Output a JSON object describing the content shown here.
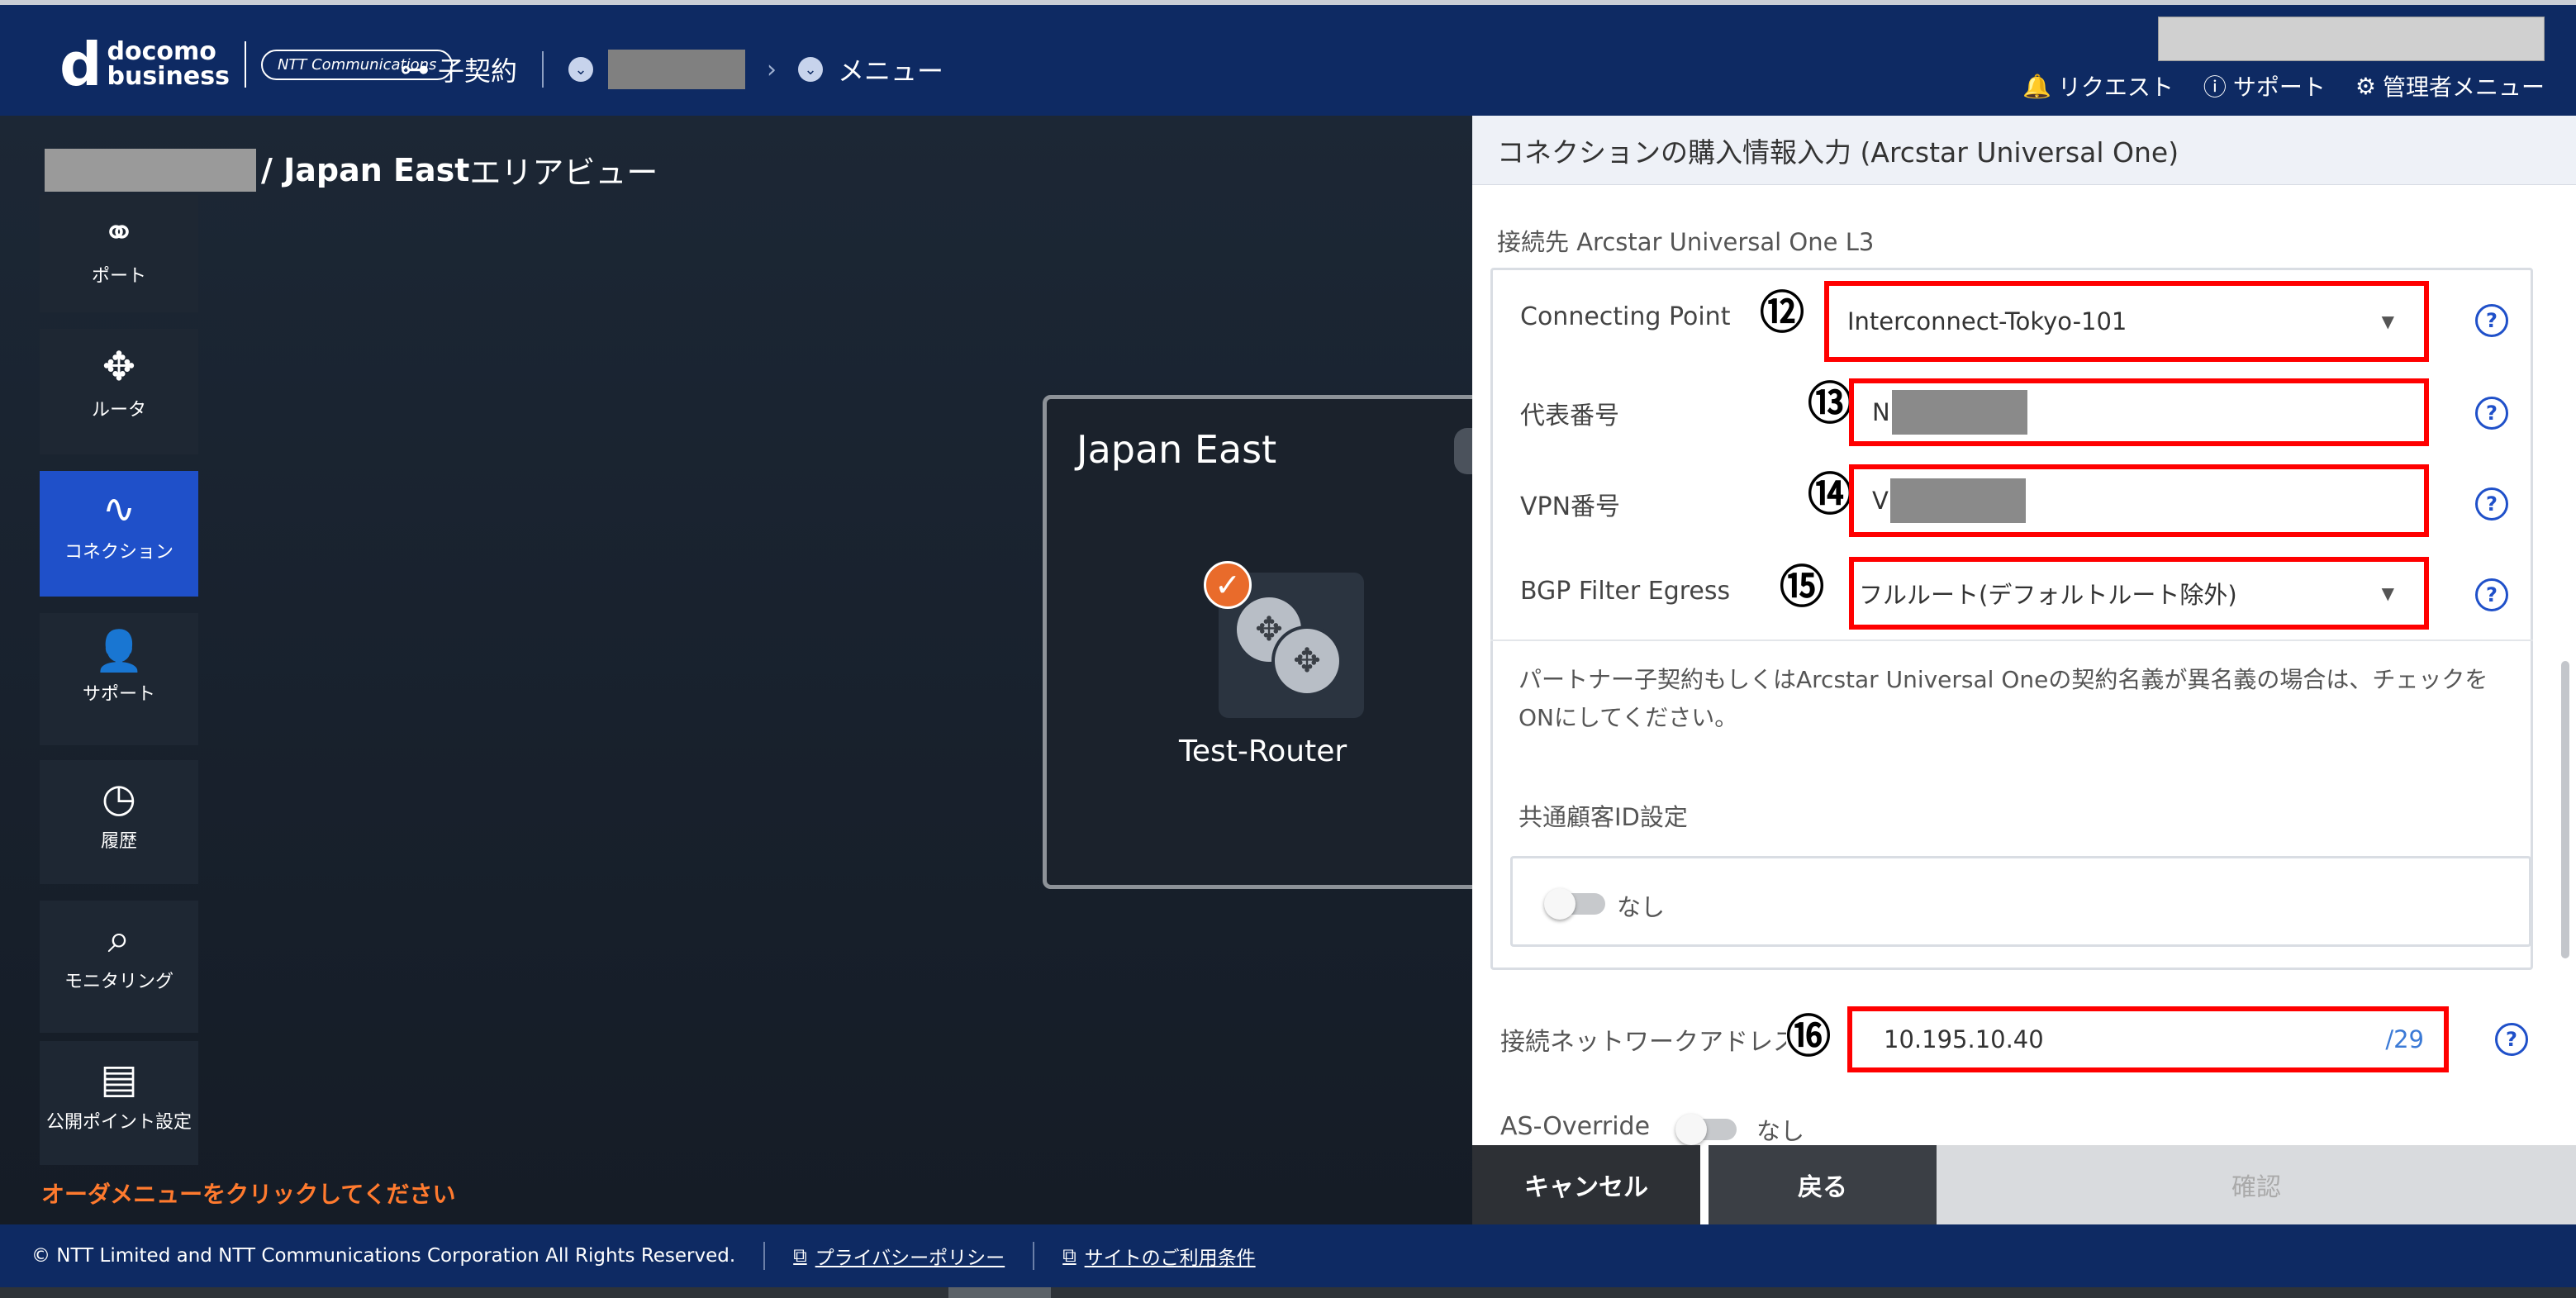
{
  "header": {
    "logo_docomo": "docomo",
    "logo_business": "business",
    "ntt_badge": "NTT Communications",
    "breadcrumb_contract": "子契約",
    "breadcrumb_menu": "メニュー",
    "links": {
      "request": "リクエスト",
      "support": "サポート",
      "admin_menu": "管理者メニュー"
    }
  },
  "area": {
    "title_suffix": "/ Japan East",
    "title_view": " エリアビュー"
  },
  "sidebar": {
    "items": [
      {
        "label": "ポート",
        "icon": "port-icon"
      },
      {
        "label": "ルータ",
        "icon": "router-icon"
      },
      {
        "label": "コネクション",
        "icon": "connection-icon"
      },
      {
        "label": "サポート",
        "icon": "support-icon"
      },
      {
        "label": "履歴",
        "icon": "history-icon"
      },
      {
        "label": "モニタリング",
        "icon": "monitoring-icon"
      },
      {
        "label": "公開ポイント設定",
        "icon": "public-point-icon"
      }
    ],
    "order_message": "オーダメニューをクリックしてください"
  },
  "region": {
    "title": "Japan East",
    "router_name": "Test-Router"
  },
  "panel": {
    "title": "コネクションの購入情報入力 (Arcstar Universal One)",
    "section_title": "接続先 Arcstar Universal One L3",
    "connecting_point": {
      "label": "Connecting Point",
      "value": "Interconnect-Tokyo-101",
      "badge": "⑫"
    },
    "representative_number": {
      "label": "代表番号",
      "value_prefix": "N",
      "badge": "⑬"
    },
    "vpn_number": {
      "label": "VPN番号",
      "value_prefix": "V",
      "badge": "⑭"
    },
    "bgp_filter": {
      "label": "BGP Filter Egress",
      "value": "フルルート(デフォルトルート除外)",
      "badge": "⑮"
    },
    "note": "パートナー子契約もしくはArcstar Universal Oneの契約名義が異名義の場合は、チェックをONにしてください。",
    "common_id_label": "共通顧客ID設定",
    "common_id_toggle": "なし",
    "network_address": {
      "label": "接続ネットワークアドレス",
      "value": "10.195.10.40",
      "suffix": "/29",
      "badge": "⑯"
    },
    "as_override": {
      "label": "AS-Override",
      "toggle": "なし"
    }
  },
  "buttons": {
    "cancel": "キャンセル",
    "back": "戻る",
    "confirm": "確認"
  },
  "footer": {
    "copyright": "© NTT Limited and NTT Communications Corporation All Rights Reserved.",
    "privacy": "プライバシーポリシー",
    "terms": "サイトのご利用条件"
  }
}
